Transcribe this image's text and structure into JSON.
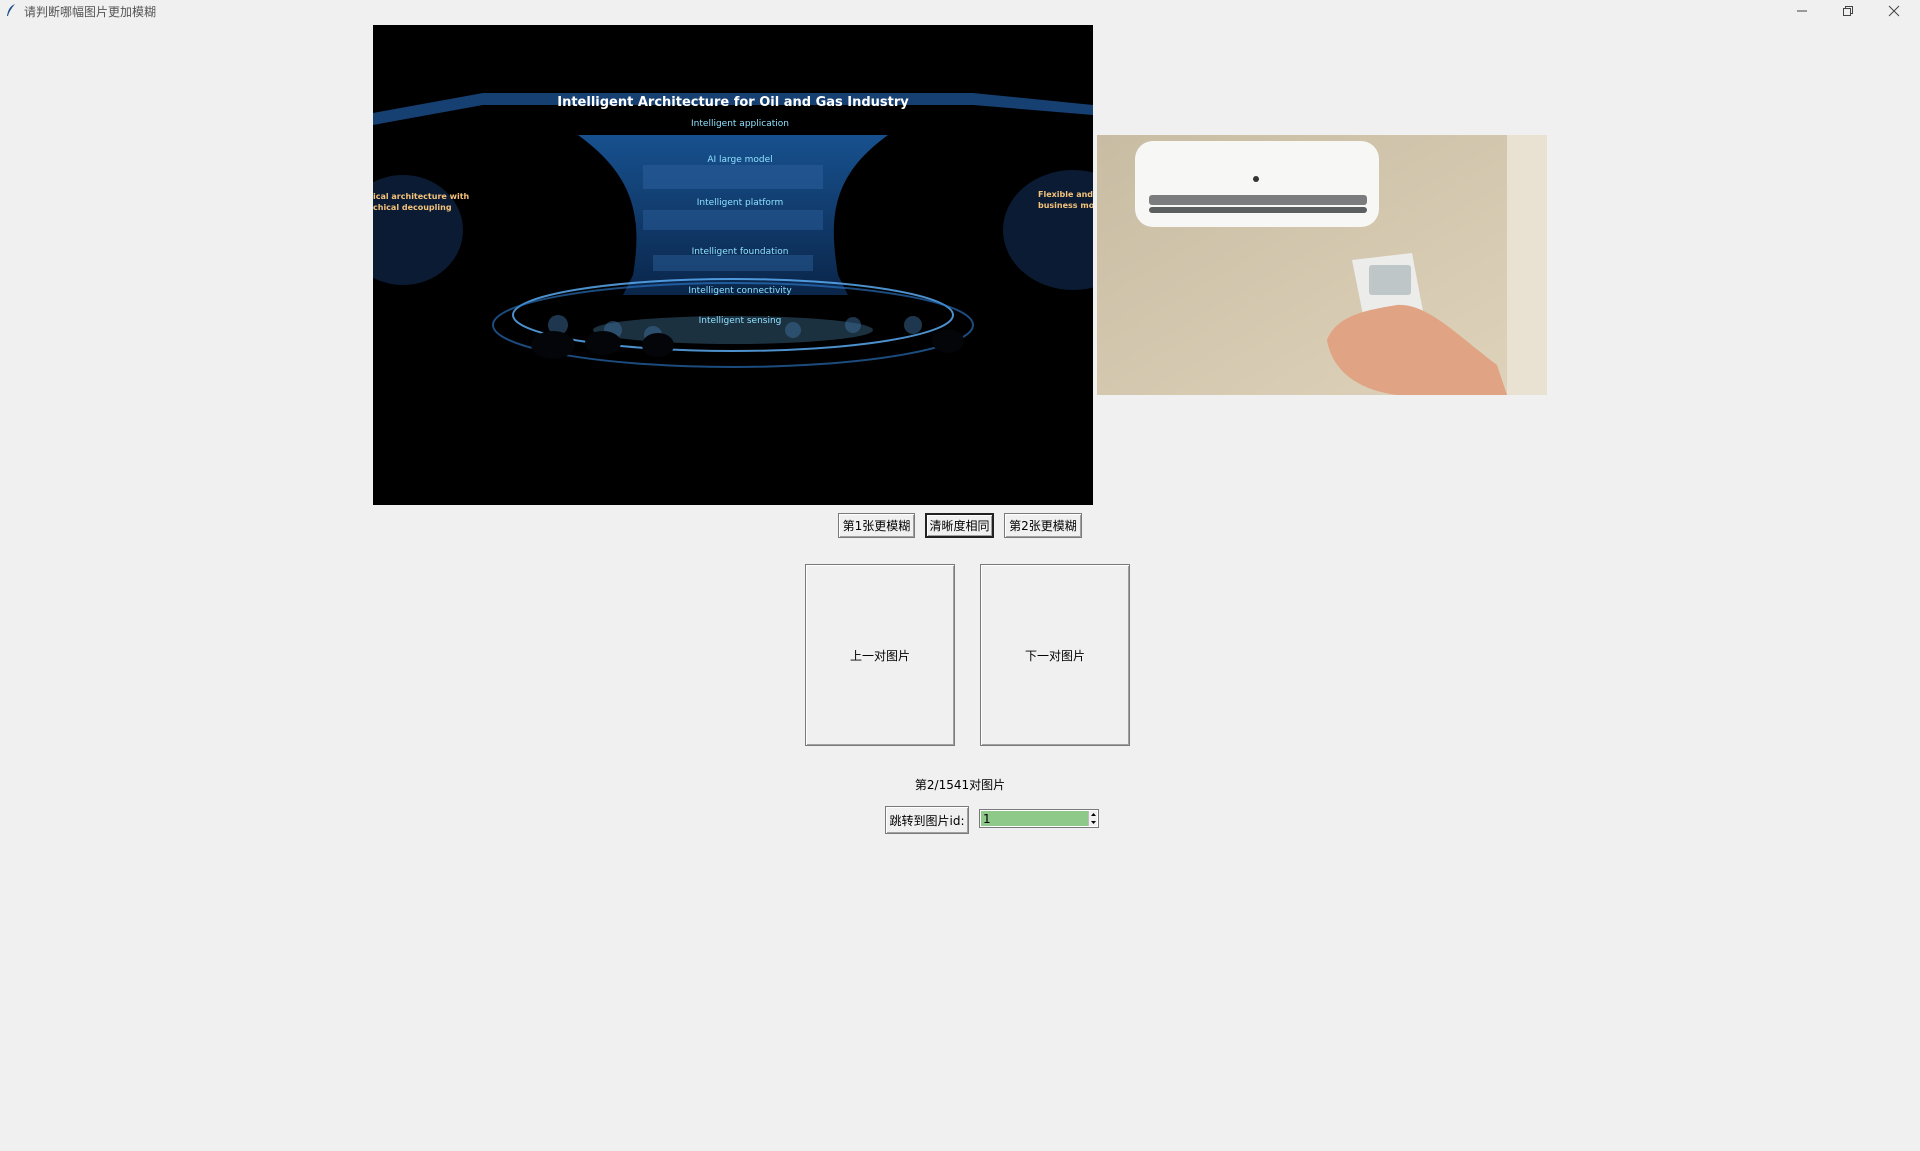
{
  "window": {
    "title": "请判断哪幅图片更加模糊",
    "app_icon": "feather-icon"
  },
  "image1": {
    "headline": "Intelligent Architecture for Oil and Gas Industry",
    "layers": [
      "Intelligent application",
      "AI large model",
      "Intelligent platform",
      "Intelligent foundation",
      "Intelligent connectivity",
      "Intelligent sensing"
    ],
    "left_panel": [
      "ical architecture with",
      "chical decoupling"
    ],
    "right_panel": [
      "Flexible and d",
      "business mod"
    ]
  },
  "image2": {
    "description_icon": "air-conditioner-remote-photo"
  },
  "choice_buttons": {
    "first_blurrier": "第1张更模糊",
    "same_clarity": "清晰度相同",
    "second_blurrier": "第2张更模糊"
  },
  "nav_buttons": {
    "prev": "上一对图片",
    "next": "下一对图片"
  },
  "counter": "第2/1541对图片",
  "jump": {
    "label": "跳转到图片id:",
    "value": "1"
  },
  "colors": {
    "background": "#f0f0f0",
    "spin_value_bg": "#8fc98a"
  }
}
